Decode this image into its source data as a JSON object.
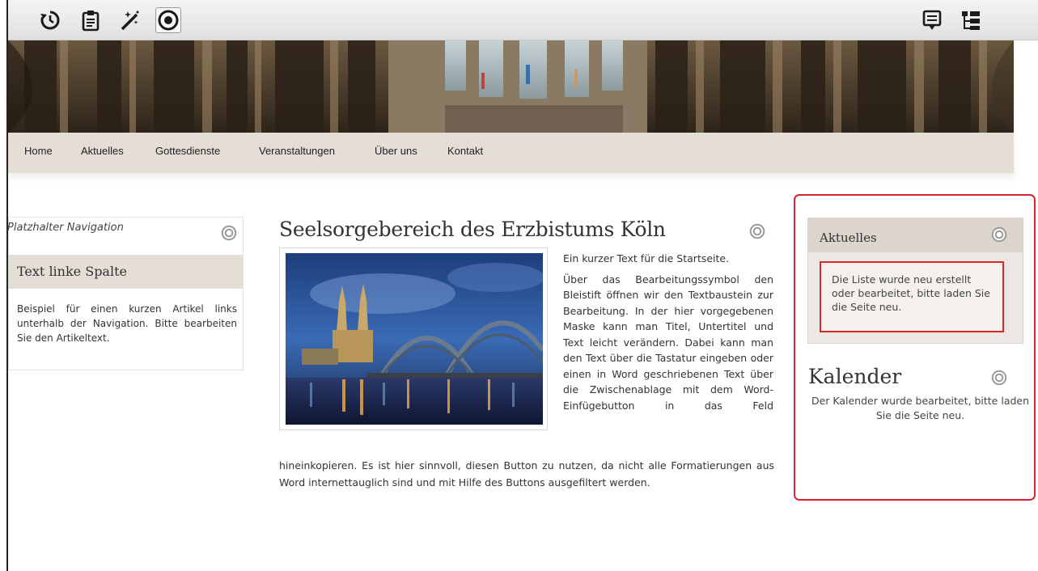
{
  "toolbar": {
    "icons": [
      "history-icon",
      "clipboard-icon",
      "magic-wand-icon",
      "target-icon",
      "list-view-icon",
      "tree-view-icon"
    ]
  },
  "nav": {
    "items": [
      {
        "label": "Home"
      },
      {
        "label": "Aktuelles"
      },
      {
        "label": "Gottesdienste"
      },
      {
        "label": "Veranstaltungen"
      },
      {
        "label": "Über uns"
      },
      {
        "label": "Kontakt"
      }
    ]
  },
  "left": {
    "placeholder": "Platzhalter Navigation",
    "heading": "Text linke Spalte",
    "text": "Beispiel für einen kurzen Artikel links unterhalb der Navigation. Bitte bearbeiten Sie den Artikeltext."
  },
  "main": {
    "title": "Seelsorgebereich des Erzbistums Köln",
    "intro": "Ein kurzer Text für die Startseite.",
    "side_text": "Über das Bearbeitungssymbol den Bleistift öffnen wir den Textbaustein zur Bearbeitung. In der hier vorgegebenen Maske kann man Titel, Untertitel und Text leicht verändern. Dabei kann man den Text über die Tastatur eingeben oder einen in Word geschriebenen Text über die Zwischenablage mit dem Word-Einfügebutton in das Feld",
    "bottom_text": "hineinkopieren. Es ist hier sinnvoll, diesen Button zu nutzen, da nicht alle Formatierungen aus Word internettauglich sind und mit Hilfe des Buttons ausgefiltert werden."
  },
  "right": {
    "aktuelles_title": "Aktuelles",
    "aktuelles_message": "Die Liste wurde neu erstellt oder bearbeitet, bitte laden Sie die Seite neu.",
    "kalender_title": "Kalender",
    "kalender_message": "Der Kalender wurde bearbeitet, bitte laden Sie die Seite neu."
  },
  "colors": {
    "highlight_red": "#d9252e",
    "nav_bg": "#e4ded7",
    "box_bg": "#dcd5cd"
  }
}
